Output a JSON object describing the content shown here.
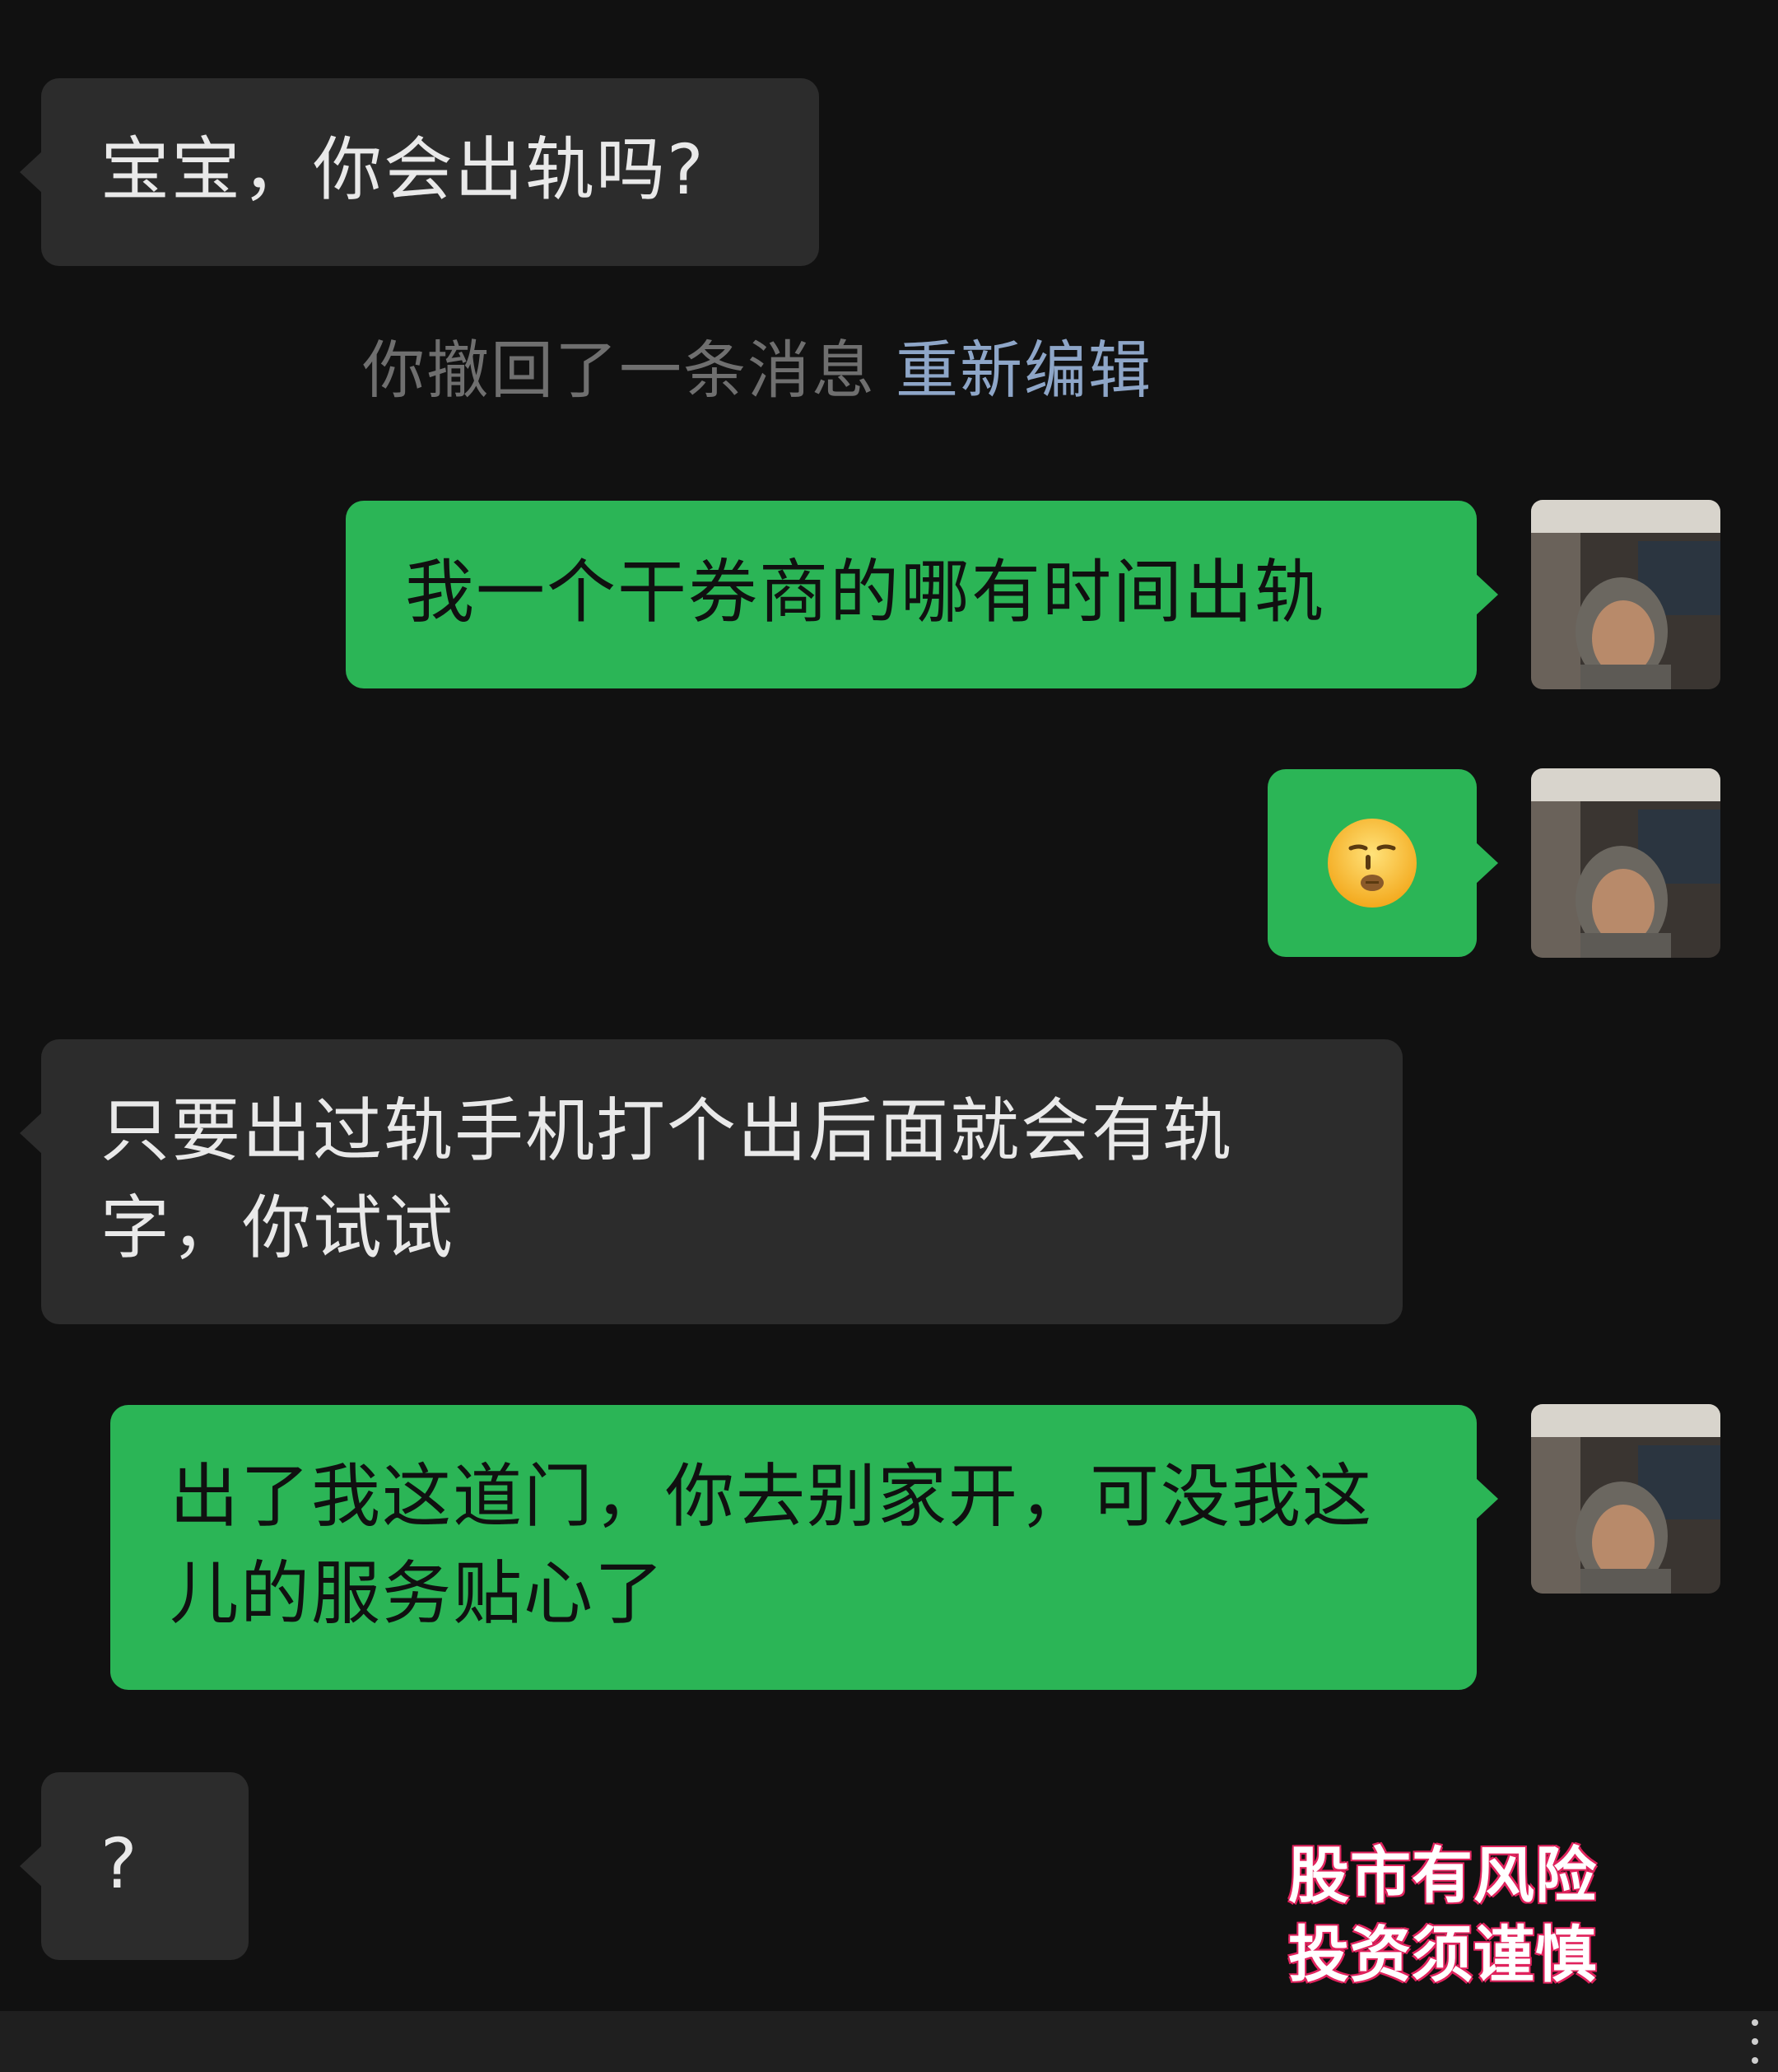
{
  "messages": {
    "m1": "宝宝，你会出轨吗?",
    "recall": "你撤回了一条消息",
    "recall_edit": "重新编辑",
    "m3": "我一个干券商的哪有时间出轨",
    "m4_icon": "expressionless-kiss-emoji",
    "m5": "只要出过轨手机打个出后面就会有轨字，你试试",
    "m6": "出了我这道门，你去别家开，可没我这儿的服务贴心了",
    "m7": "?"
  },
  "watermark": {
    "line1": "股市有风险",
    "line2": "投资须谨慎"
  },
  "colors": {
    "background": "#111111",
    "incoming_bubble": "#2c2c2c",
    "outgoing_bubble": "#2bb556",
    "recall_text": "#6f6f6f",
    "edit_link": "#8ea6c8",
    "watermark_outline": "#e0245e"
  }
}
